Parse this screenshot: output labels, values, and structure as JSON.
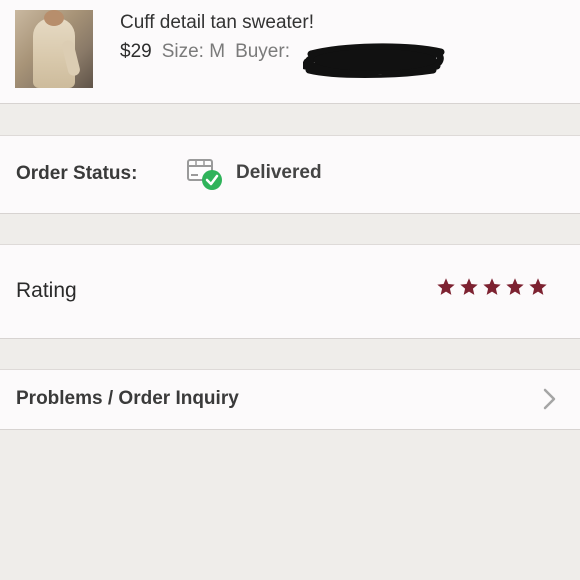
{
  "product": {
    "title": "Cuff detail tan sweater!",
    "price": "$29",
    "size_label": "Size:",
    "size_value": "M",
    "buyer_label": "Buyer:"
  },
  "order_status": {
    "label": "Order Status:",
    "value": "Delivered",
    "icon": "package-delivered-icon",
    "check_color": "#2fb35a"
  },
  "rating": {
    "label": "Rating",
    "stars_filled": 5,
    "stars_total": 5,
    "star_color": "#7d2231"
  },
  "inquiry": {
    "label": "Problems / Order Inquiry",
    "icon": "chevron-right-icon"
  }
}
